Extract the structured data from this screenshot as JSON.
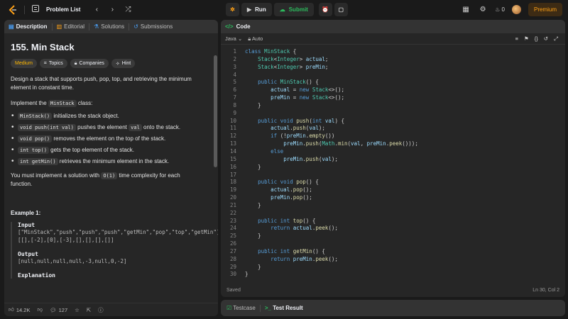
{
  "topbar": {
    "problem_list": "Problem List",
    "run": "Run",
    "submit": "Submit",
    "streak": "0",
    "premium": "Premium"
  },
  "description_tabs": [
    {
      "label": "Description",
      "active": true
    },
    {
      "label": "Editorial",
      "active": false
    },
    {
      "label": "Solutions",
      "active": false
    },
    {
      "label": "Submissions",
      "active": false
    }
  ],
  "problem": {
    "title": "155. Min Stack",
    "difficulty": "Medium",
    "chips": [
      "Topics",
      "Companies",
      "Hint"
    ],
    "intro": "Design a stack that supports push, pop, top, and retrieving the minimum element in constant time.",
    "implement_prefix": "Implement the ",
    "implement_code": "MinStack",
    "implement_suffix": " class:",
    "methods": [
      {
        "code": "MinStack()",
        "text": " initializes the stack object."
      },
      {
        "code": "void push(int val)",
        "text": " pushes the element ",
        "code2": "val",
        "text2": " onto the stack."
      },
      {
        "code": "void pop()",
        "text": " removes the element on the top of the stack."
      },
      {
        "code": "int top()",
        "text": " gets the top element of the stack."
      },
      {
        "code": "int getMin()",
        "text": " retrieves the minimum element in the stack."
      }
    ],
    "complexity_prefix": "You must implement a solution with ",
    "complexity_code": "O(1)",
    "complexity_suffix": " time complexity for each function.",
    "example_title": "Example 1:",
    "input_label": "Input",
    "input_value_1": "[\"MinStack\",\"push\",\"push\",\"push\",\"getMin\",\"pop\",\"top\",\"getMin\"]",
    "input_value_2": "[[],[-2],[0],[-3],[],[],[],[]]",
    "output_label": "Output",
    "output_value": "[null,null,null,null,-3,null,0,-2]",
    "explanation_label": "Explanation"
  },
  "footer": {
    "likes": "14.2K",
    "comments": "127"
  },
  "code_panel": {
    "title": "Code",
    "language": "Java",
    "mode": "Auto",
    "status_left": "Saved",
    "status_right": "Ln 30, Col 2"
  },
  "code_lines": [
    "class MinStack {",
    "    Stack<Integer> actual;",
    "    Stack<Integer> preMin;",
    "",
    "    public MinStack() {",
    "        actual = new Stack<>();",
    "        preMin = new Stack<>();",
    "    }",
    "",
    "    public void push(int val) {",
    "        actual.push(val);",
    "        if (!preMin.empty())",
    "            preMin.push(Math.min(val, preMin.peek()));",
    "        else",
    "            preMin.push(val);",
    "    }",
    "",
    "    public void pop() {",
    "        actual.pop();",
    "        preMin.pop();",
    "    }",
    "",
    "    public int top() {",
    "        return actual.peek();",
    "    }",
    "",
    "    public int getMin() {",
    "        return preMin.peek();",
    "    }",
    "}"
  ],
  "bottom_tabs": {
    "testcase": "Testcase",
    "test_result": "Test Result"
  }
}
